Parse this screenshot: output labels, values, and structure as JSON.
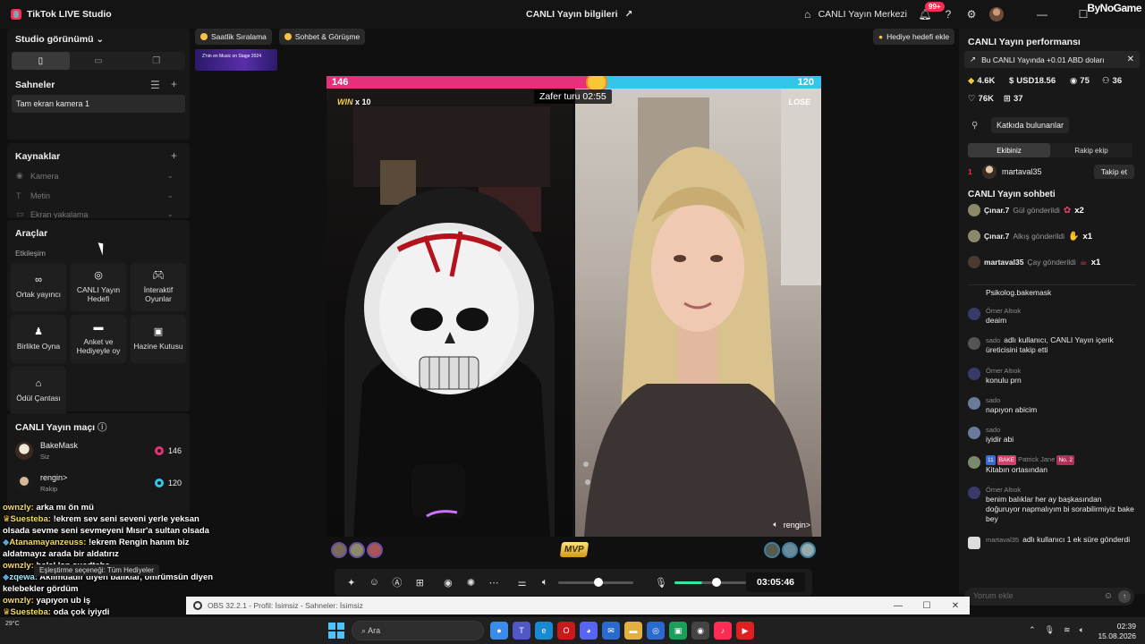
{
  "titlebar": {
    "app_name": "TikTok LIVE Studio",
    "center_title": "CANLI Yayın bilgileri",
    "live_center": "CANLI Yayın Merkezi",
    "notif_badge": "99+",
    "watermark": "ByNoGame"
  },
  "left": {
    "studio_view": "Studio görünümü",
    "scenes_title": "Sahneler",
    "scene_item": "Tam ekran kamera 1",
    "sources_title": "Kaynaklar",
    "sources": [
      "Kamera",
      "Metin",
      "Ekran yakalama"
    ],
    "tools_title": "Araçlar",
    "interaction_label": "Etkileşim",
    "tools": [
      {
        "label": "Ortak yayıncı",
        "icon": "link-icon"
      },
      {
        "label": "CANLI Yayın Hedefi",
        "icon": "target-icon"
      },
      {
        "label": "İnteraktif Oyunlar",
        "icon": "gamepad-icon"
      },
      {
        "label": "Birlikte Oyna",
        "icon": "joystick-icon"
      },
      {
        "label": "Anket ve Hediyeyle oy",
        "icon": "poll-icon"
      },
      {
        "label": "Hazine Kutusu",
        "icon": "treasure-icon"
      },
      {
        "label": "Ödül Çantası",
        "icon": "bag-icon"
      }
    ],
    "match_title": "CANLI Yayın maçı",
    "match": [
      {
        "name": "BakeMask",
        "sub": "Siz",
        "score": "146"
      },
      {
        "name": "rengin>",
        "sub": "Rakip",
        "score": "120"
      }
    ]
  },
  "overlay_chat": [
    {
      "name": "ownzly:",
      "text": "arka mı ön mü"
    },
    {
      "name": "Suesteba:",
      "text": "!ekrem sev seni seveni yerle yeksan olsada sevme seni sevmeyeni Mısır'a sultan olsada"
    },
    {
      "name": "Atanamayanzeuss:",
      "text": "!ekrem Rengin hanım biz aldatmayız arada bir aldatırız"
    },
    {
      "name": "ownzly:",
      "text": "helal lan suedteba"
    },
    {
      "name": "zqewa:",
      "text": "Aklımdadır diyen balıklar, ömrümsün diyen kelebekler gördüm"
    },
    {
      "name": "ownzly:",
      "text": "yapıyon ub iş"
    },
    {
      "name": "Suesteba:",
      "text": "oda çok iyiydi"
    }
  ],
  "overlay_tip": "Eşleştirme seçeneği: Tüm Hediyeler",
  "center": {
    "chip_hourly": "Saatlik Sıralama",
    "chip_chat": "Sohbet & Görüşme",
    "chip_goal": "Hediye hedefi ekle",
    "banner_text": "Z'nin en Music on Stage 2024",
    "score_left": "146",
    "score_right": "120",
    "timer": "Zafer turu 02:55",
    "win_label": "WIN",
    "win_mult": "x 10",
    "lose_label": "LOSE",
    "opponent_label": "rengin>",
    "mvp": "MVP",
    "elapsed": "03:05:46"
  },
  "right": {
    "perf_title": "CANLI Yayın performansı",
    "perf_banner": "Bu CANLI Yayında +0.01 ABD doları",
    "stats": {
      "diamonds": "4.6K",
      "usd": "USD18.56",
      "viewers": "75",
      "users": "36",
      "likes": "76K",
      "gifts": "37"
    },
    "contributors": "Katkıda bulunanlar",
    "team_tabs": [
      "Ekibiniz",
      "Rakip ekip"
    ],
    "rank": {
      "num": "1",
      "name": "martaval35",
      "follow": "Takip et"
    },
    "chat_title": "CANLI Yayın sohbeti",
    "gifts": [
      {
        "name": "Çınar.7",
        "action": "Gül gönderildi",
        "count": "x2"
      },
      {
        "name": "Çınar.7",
        "action": "Alkış gönderildi",
        "count": "x1"
      },
      {
        "name": "martaval35",
        "action": "Çay gönderildi",
        "count": "x1"
      }
    ],
    "messages": [
      {
        "name": "",
        "text": "Psikolog.bakemask"
      },
      {
        "name": "Ömer Altıok",
        "text": "deaim"
      },
      {
        "name": "sado",
        "text": "adlı kullanıcı, CANLI Yayın içerik üreticisini takip etti"
      },
      {
        "name": "Ömer Altıok",
        "text": "konulu prn"
      },
      {
        "name": "sado",
        "text": "napıyon abicim"
      },
      {
        "name": "sado",
        "text": "iyidir abi"
      },
      {
        "name": "Patrick Jane",
        "text": "Kitabın ortasından",
        "tag1": "11",
        "tag2": "BAKE",
        "tag3": "No. 2"
      },
      {
        "name": "Ömer Altıok",
        "text": "benim balıklar her ay başkasından doğuruyor napmalıyım bi sorabilirmiyiz bake bey"
      },
      {
        "name": "martaval35",
        "text": "adlı kullanıcı 1 ek süre gönderdi"
      }
    ],
    "input_placeholder": "Yorum ekle"
  },
  "obs": {
    "title": "OBS 32.2.1 - Profil: İsimsiz - Sahneler: İsimsiz"
  },
  "taskbar": {
    "search": "Ara",
    "time": "02:39",
    "date": "15.08.2026",
    "weather": "29°C"
  }
}
